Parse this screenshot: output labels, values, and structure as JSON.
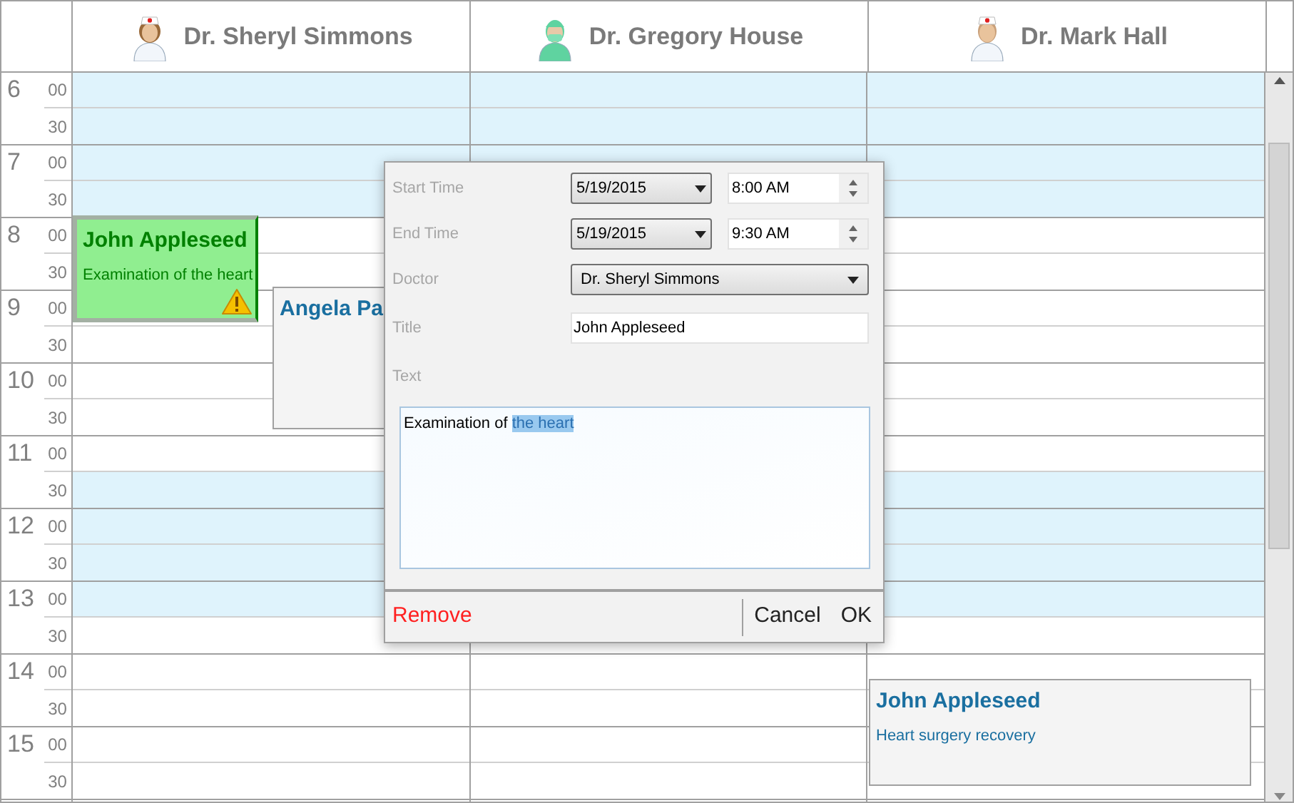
{
  "doctors": [
    {
      "name": "Dr. Sheryl Simmons",
      "kind": "nurse",
      "appointments": [
        {
          "title": "John Appleseed",
          "text": "Examination of the heart",
          "selected": true,
          "warning": true
        },
        {
          "title": "Angela Pa",
          "selected": false
        }
      ]
    },
    {
      "name": "Dr. Gregory House",
      "kind": "surgeon"
    },
    {
      "name": "Dr. Mark Hall",
      "kind": "doctor",
      "appointments": [
        {
          "title": "John Appleseed",
          "text": "Heart surgery recovery",
          "selected": false
        }
      ]
    }
  ],
  "hours": [
    {
      "label": "6",
      "slots": [
        {
          "label": "00",
          "shaded": true
        },
        {
          "label": "30",
          "shaded": true
        }
      ]
    },
    {
      "label": "7",
      "slots": [
        {
          "label": "00",
          "shaded": true
        },
        {
          "label": "30",
          "shaded": true
        }
      ]
    },
    {
      "label": "8",
      "slots": [
        {
          "label": "00",
          "shaded": false
        },
        {
          "label": "30",
          "shaded": false
        }
      ]
    },
    {
      "label": "9",
      "slots": [
        {
          "label": "00",
          "shaded": false
        },
        {
          "label": "30",
          "shaded": false
        }
      ]
    },
    {
      "label": "10",
      "slots": [
        {
          "label": "00",
          "shaded": false
        },
        {
          "label": "30",
          "shaded": false
        }
      ]
    },
    {
      "label": "11",
      "slots": [
        {
          "label": "00",
          "shaded": false
        },
        {
          "label": "30",
          "shaded": true
        }
      ]
    },
    {
      "label": "12",
      "slots": [
        {
          "label": "00",
          "shaded": true
        },
        {
          "label": "30",
          "shaded": true
        }
      ]
    },
    {
      "label": "13",
      "slots": [
        {
          "label": "00",
          "shaded": true
        },
        {
          "label": "30",
          "shaded": false
        }
      ]
    },
    {
      "label": "14",
      "slots": [
        {
          "label": "00",
          "shaded": false
        },
        {
          "label": "30",
          "shaded": false
        }
      ]
    },
    {
      "label": "15",
      "slots": [
        {
          "label": "00",
          "shaded": false
        },
        {
          "label": "30",
          "shaded": false
        }
      ]
    }
  ],
  "dialog": {
    "start_time": {
      "label": "Start Time",
      "date": "5/19/2015",
      "time": "8:00 AM"
    },
    "end_time": {
      "label": "End Time",
      "date": "5/19/2015",
      "time": "9:30 AM"
    },
    "doctor": {
      "label": "Doctor",
      "value": "Dr. Sheryl Simmons"
    },
    "title": {
      "label": "Title",
      "value": "John Appleseed"
    },
    "text": {
      "label": "Text",
      "value_parts": [
        {
          "text": "Examination of ",
          "selected": false
        },
        {
          "text": "the heart",
          "selected": true
        }
      ]
    },
    "remove": "Remove",
    "cancel": "Cancel",
    "ok": "OK"
  }
}
